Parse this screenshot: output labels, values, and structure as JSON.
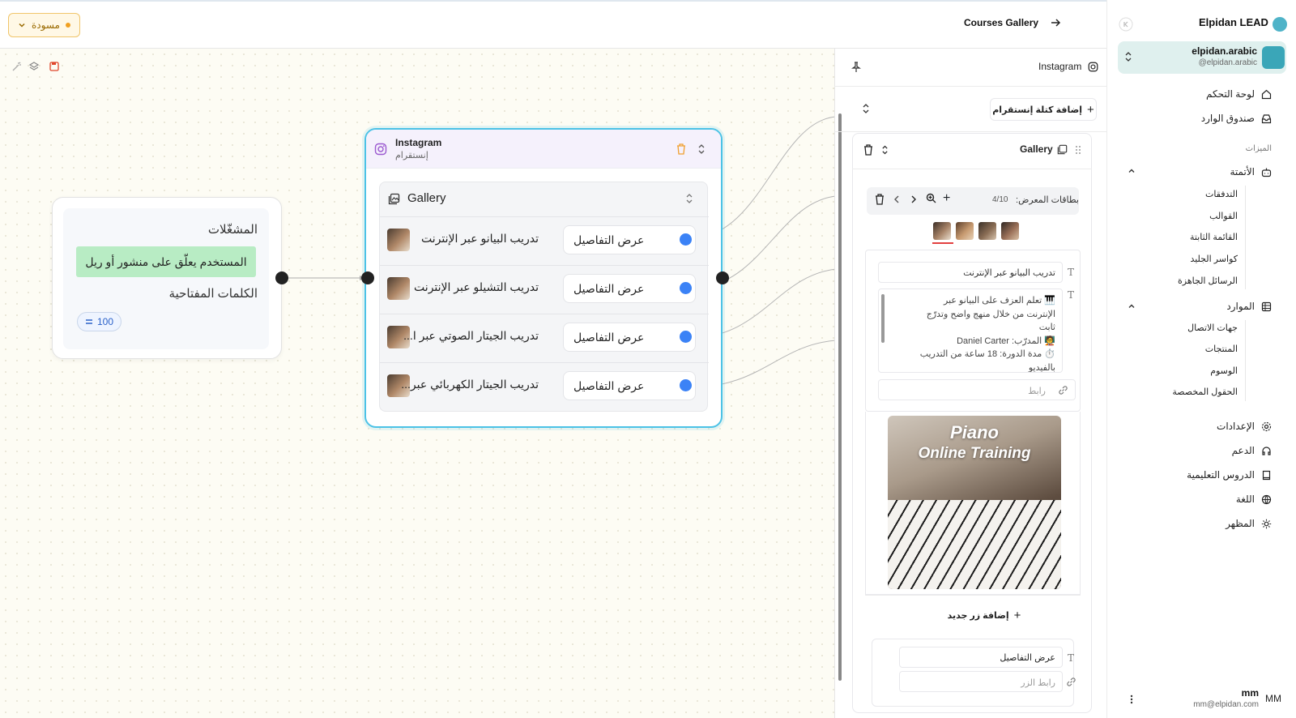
{
  "topbar": {
    "draft_label": "مسودة",
    "flow_title": "Courses Gallery"
  },
  "trigger": {
    "title": "المشغّلات",
    "condition": "المستخدم يعلّق على منشور أو ريل",
    "keywords_label": "الكلمات المفتاحية",
    "keyword_badge": "100"
  },
  "node": {
    "title": "Instagram",
    "subtitle": "إنستقرام",
    "gallery_title": "Gallery",
    "rows": [
      {
        "name": "تدريب البيانو عبر الإنترنت",
        "button": "عرض التفاصيل"
      },
      {
        "name": "تدريب التشيلو عبر الإنترنت",
        "button": "عرض التفاصيل"
      },
      {
        "name": "تدريب الجيتار الصوتي عبر ا...",
        "button": "عرض التفاصيل"
      },
      {
        "name": "تدريب الجيتار الكهربائي عبر...",
        "button": "عرض التفاصيل"
      }
    ]
  },
  "editor": {
    "channel": "Instagram",
    "add_block": "إضافة كتلة إنستقرام",
    "block_title": "Gallery",
    "cards_label": "بطاقات المعرض:",
    "cards_count": "4/10",
    "card_title": "تدريب البيانو عبر الإنترنت",
    "card_desc_1": "🎹 تعلم العزف على البيانو عبر",
    "card_desc_2": "الإنترنت من خلال منهج واضح وتدرّج",
    "card_desc_3": "ثابت",
    "card_desc_4": "🧑‍🏫 المدرّب: Daniel Carter",
    "card_desc_5": "⏱️ مدة الدورة: 18 ساعة من التدريب",
    "card_desc_6": "بالفيديو",
    "link_placeholder": "رابط",
    "image_text_1": "Piano",
    "image_text_2": "Online Training",
    "add_button": "إضافة زر جديد",
    "button_label": "عرض التفاصيل",
    "button_link_placeholder": "رابط الزر"
  },
  "sidebar": {
    "brand": "Elpidan LEAD",
    "account_name": "elpidan.arabic",
    "account_handle": "@elpidan.arabic",
    "dashboard": "لوحة التحكم",
    "inbox": "صندوق الوارد",
    "features_heading": "الميزات",
    "automation": "الأتمتة",
    "automation_items": [
      "التدفقات",
      "القوالب",
      "القائمة الثابتة",
      "كواسر الجليد",
      "الرسائل الجاهزة"
    ],
    "resources": "الموارد",
    "resources_items": [
      "جهات الاتصال",
      "المنتجات",
      "الوسوم",
      "الحقول المخصصة"
    ],
    "settings": "الإعدادات",
    "support": "الدعم",
    "tutorials": "الدروس التعليمية",
    "language": "اللغة",
    "appearance": "المظهر",
    "user_name": "mm",
    "user_email": "mm@elpidan.com",
    "user_initials": "MM"
  },
  "colors": {
    "accent_node": "#4cc2e6",
    "condition_bg": "#b8ecc4",
    "dot_blue": "#3b82f6",
    "draft_border": "#f0c56a"
  }
}
